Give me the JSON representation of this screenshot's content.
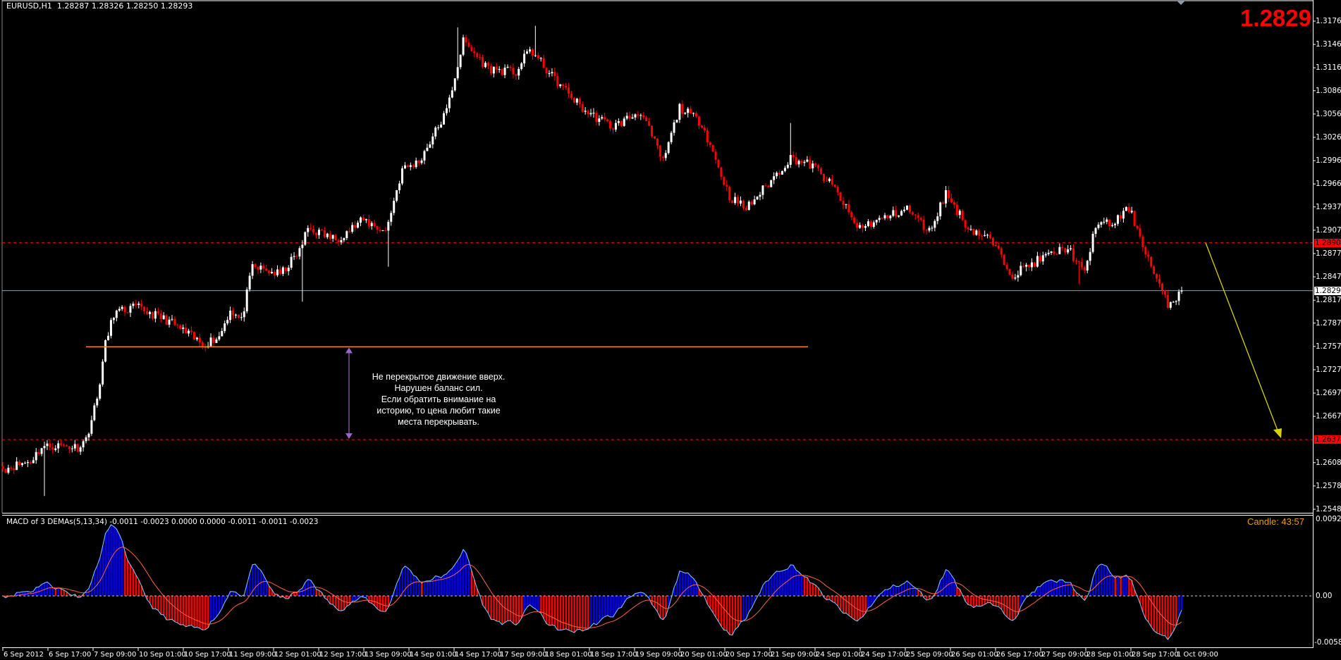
{
  "header": {
    "symbol": "EURUSD,H1",
    "ohlc": "1.28287 1.28326 1.28250 1.28293"
  },
  "big_price": "1.2829",
  "candle_timer": "Candle:  43:57",
  "annotation": {
    "lines": [
      "Не перекрытое движение вверх.",
      "Нарушен баланс сил.",
      "Если обратить внимание на",
      "историю, то цена любит такие",
      "места перекрывать."
    ]
  },
  "macd": {
    "label": "MACD of 3 DEMAs(5,13,34) -0.0011 -0.0023 0.0000 0.0000 -0.0011 -0.0011 -0.0023",
    "axis_labels": [
      "0.0092",
      "0.00",
      "-0.0058"
    ]
  },
  "colors": {
    "bull": "#ffffff",
    "bear": "#ff0000",
    "level": "#ff0000",
    "bid_line": "#8a9aa8",
    "support": "#ff8c00",
    "measure_arrow": "#9966cc",
    "forecast_arrow": "#d4d400",
    "macd_pos": "#0000ff",
    "macd_neg": "#ff0000",
    "macd_line": "#87cefa",
    "signal_line": "#ff6347"
  },
  "chart_data": {
    "type": "candlestick",
    "title": "EURUSD,H1",
    "price_ticks": [
      "1.31760",
      "1.31460",
      "1.31160",
      "1.30865",
      "1.30565",
      "1.30265",
      "1.29965",
      "1.29665",
      "1.29370",
      "1.29070",
      "1.28770",
      "1.28470",
      "1.28170",
      "1.27875",
      "1.27575",
      "1.27275",
      "1.26975",
      "1.26675",
      "1.26080",
      "1.25780",
      "1.25480"
    ],
    "levels": {
      "resistance": "1.28909",
      "bid": "1.28293",
      "target": "1.26376",
      "support_level": 1.2757
    },
    "time_labels": [
      "6 Sep 2012",
      "6 Sep 17:00",
      "7 Sep 09:00",
      "10 Sep 01:00",
      "10 Sep 17:00",
      "11 Sep 09:00",
      "12 Sep 01:00",
      "12 Sep 17:00",
      "13 Sep 09:00",
      "14 Sep 01:00",
      "14 Sep 17:00",
      "17 Sep 09:00",
      "18 Sep 01:00",
      "18 Sep 17:00",
      "19 Sep 09:00",
      "20 Sep 01:00",
      "20 Sep 17:00",
      "21 Sep 09:00",
      "24 Sep 01:00",
      "24 Sep 17:00",
      "25 Sep 09:00",
      "26 Sep 01:00",
      "26 Sep 17:00",
      "27 Sep 09:00",
      "28 Sep 01:00",
      "28 Sep 17:00",
      "1 Oct 09:00"
    ],
    "close_keypoints": [
      [
        0,
        1.26
      ],
      [
        10,
        1.261
      ],
      [
        14,
        1.2628
      ],
      [
        20,
        1.263
      ],
      [
        27,
        1.2628
      ],
      [
        30,
        1.2638
      ],
      [
        34,
        1.269
      ],
      [
        37,
        1.276
      ],
      [
        40,
        1.28
      ],
      [
        48,
        1.2808
      ],
      [
        60,
        1.279
      ],
      [
        72,
        1.276
      ],
      [
        78,
        1.277
      ],
      [
        82,
        1.2805
      ],
      [
        86,
        1.279
      ],
      [
        90,
        1.286
      ],
      [
        100,
        1.285
      ],
      [
        107,
        1.288
      ],
      [
        110,
        1.291
      ],
      [
        120,
        1.2895
      ],
      [
        130,
        1.292
      ],
      [
        138,
        1.2905
      ],
      [
        144,
        1.2985
      ],
      [
        150,
        1.2995
      ],
      [
        160,
        1.306
      ],
      [
        166,
        1.315
      ],
      [
        175,
        1.3115
      ],
      [
        185,
        1.311
      ],
      [
        190,
        1.314
      ],
      [
        198,
        1.3105
      ],
      [
        210,
        1.306
      ],
      [
        220,
        1.304
      ],
      [
        230,
        1.306
      ],
      [
        238,
        1.2995
      ],
      [
        244,
        1.3065
      ],
      [
        252,
        1.3045
      ],
      [
        262,
        1.295
      ],
      [
        268,
        1.2935
      ],
      [
        278,
        1.2975
      ],
      [
        284,
        1.3
      ],
      [
        292,
        1.299
      ],
      [
        300,
        1.296
      ],
      [
        308,
        1.291
      ],
      [
        316,
        1.292
      ],
      [
        326,
        1.2935
      ],
      [
        334,
        1.2905
      ],
      [
        340,
        1.2955
      ],
      [
        348,
        1.291
      ],
      [
        356,
        1.2895
      ],
      [
        364,
        1.285
      ],
      [
        374,
        1.287
      ],
      [
        384,
        1.2885
      ],
      [
        390,
        1.285
      ],
      [
        394,
        1.2915
      ],
      [
        400,
        1.2915
      ],
      [
        406,
        1.2935
      ],
      [
        410,
        1.29
      ],
      [
        414,
        1.286
      ],
      [
        420,
        1.281
      ],
      [
        425,
        1.28293
      ]
    ],
    "spikes": [
      [
        15,
        1.2565
      ],
      [
        108,
        1.2815
      ],
      [
        139,
        1.286
      ],
      [
        164,
        1.3168
      ],
      [
        192,
        1.317
      ],
      [
        284,
        1.3045
      ],
      [
        388,
        1.2838
      ]
    ],
    "macd_range": [
      -0.0058,
      0.0092
    ]
  }
}
